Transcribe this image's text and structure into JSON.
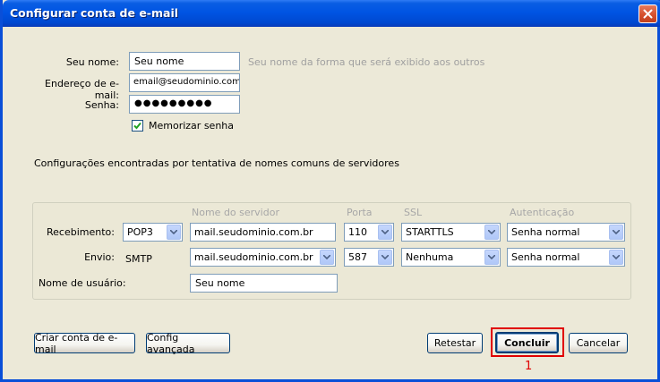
{
  "window": {
    "title": "Configurar conta de e-mail"
  },
  "form": {
    "name_label": "Seu nome:",
    "name_value": "Seu nome",
    "name_hint": "Seu nome da forma que será exibido aos outros",
    "email_label": "Endereço de e-mail:",
    "email_value": "email@seudominio.com.br",
    "password_label": "Senha:",
    "password_value": "●●●●●●●●●",
    "remember_label": "Memorizar senha",
    "remember_checked": true
  },
  "status_text": "Configurações encontradas por tentativa de nomes comuns de servidores",
  "server_table": {
    "headers": {
      "server": "Nome do servidor",
      "port": "Porta",
      "ssl": "SSL",
      "auth": "Autenticação"
    },
    "incoming": {
      "label": "Recebimento:",
      "protocol": "POP3",
      "server": "mail.seudominio.com.br",
      "port": "110",
      "ssl": "STARTTLS",
      "auth": "Senha normal"
    },
    "outgoing": {
      "label": "Envio:",
      "protocol": "SMTP",
      "server": "mail.seudominio.com.br",
      "port": "587",
      "ssl": "Nenhuma",
      "auth": "Senha normal"
    },
    "username": {
      "label": "Nome de usuário:",
      "value": "Seu nome"
    }
  },
  "buttons": {
    "create_account": "Criar conta de e-mail",
    "advanced": "Config avançada",
    "retest": "Retestar",
    "done": "Concluir",
    "cancel": "Cancelar"
  },
  "annotation": {
    "callout": "1",
    "color": "#e00000"
  },
  "colors": {
    "titlebar": "#0054e3",
    "dialog_bg": "#ece9d8",
    "highlight": "#e00000"
  }
}
